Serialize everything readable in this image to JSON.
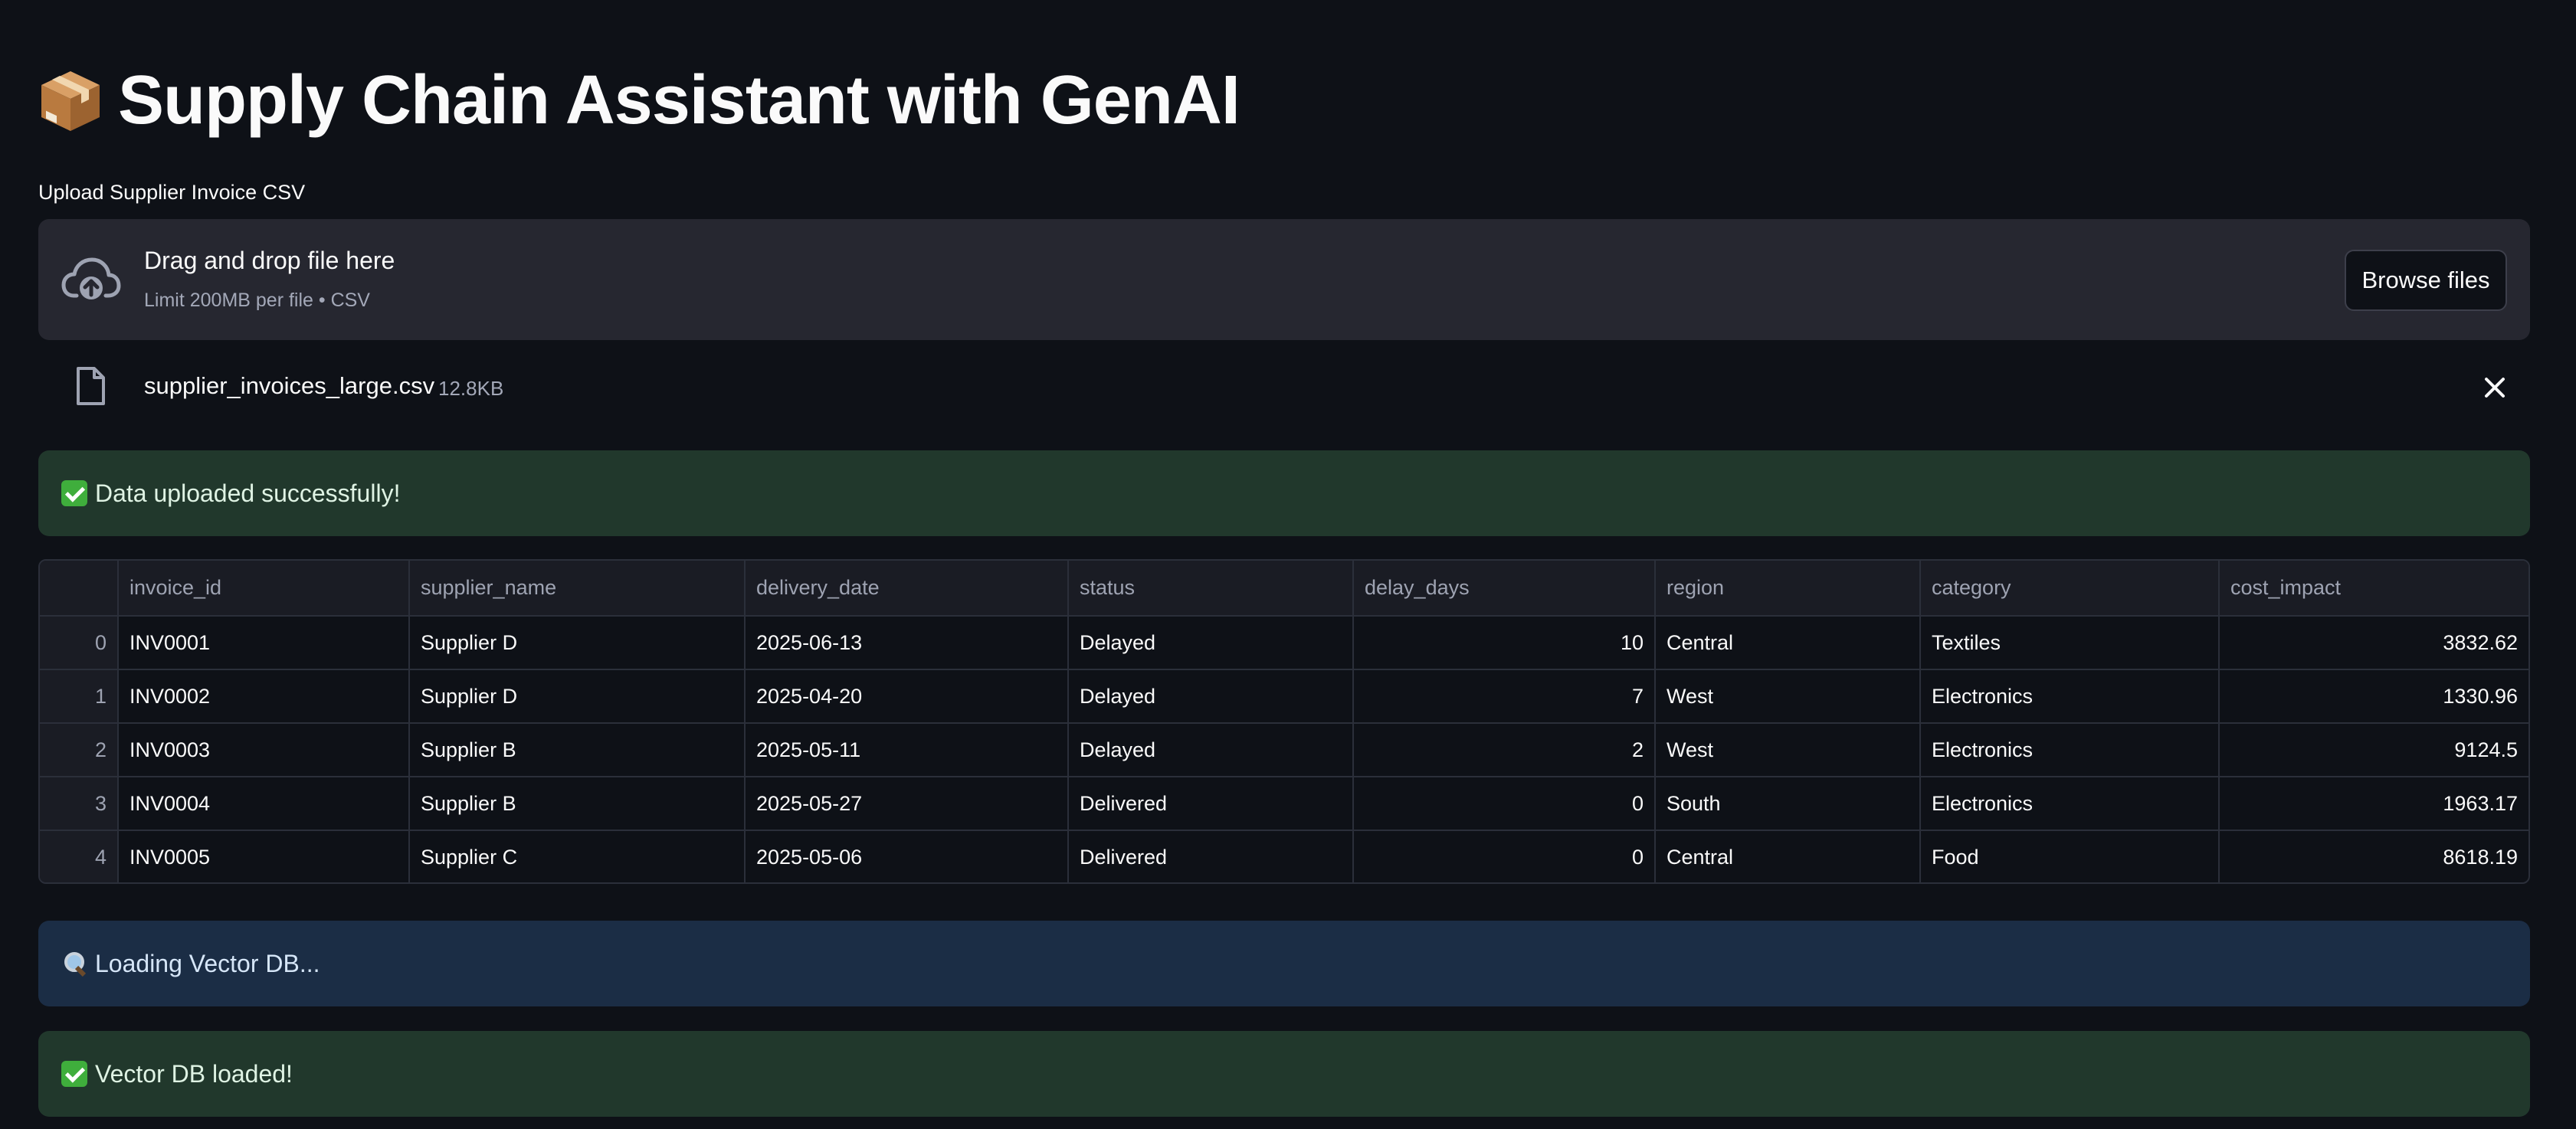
{
  "header": {
    "title": "Supply Chain Assistant with GenAI",
    "title_icon": "package-icon"
  },
  "uploader": {
    "label": "Upload Supplier Invoice CSV",
    "drop_text": "Drag and drop file here",
    "limit_text": "Limit 200MB per file • CSV",
    "browse_label": "Browse files",
    "file_name": "supplier_invoices_large.csv",
    "file_size": "12.8KB"
  },
  "alerts": {
    "upload_success": "Data uploaded successfully!",
    "loading_db": "Loading Vector DB...",
    "db_loaded": "Vector DB loaded!"
  },
  "table": {
    "columns": [
      "",
      "invoice_id",
      "supplier_name",
      "delivery_date",
      "status",
      "delay_days",
      "region",
      "category",
      "cost_impact"
    ],
    "rows": [
      [
        "0",
        "INV0001",
        "Supplier D",
        "2025-06-13",
        "Delayed",
        "10",
        "Central",
        "Textiles",
        "3832.62"
      ],
      [
        "1",
        "INV0002",
        "Supplier D",
        "2025-04-20",
        "Delayed",
        "7",
        "West",
        "Electronics",
        "1330.96"
      ],
      [
        "2",
        "INV0003",
        "Supplier B",
        "2025-05-11",
        "Delayed",
        "2",
        "West",
        "Electronics",
        "9124.5"
      ],
      [
        "3",
        "INV0004",
        "Supplier B",
        "2025-05-27",
        "Delivered",
        "0",
        "South",
        "Electronics",
        "1963.17"
      ],
      [
        "4",
        "INV0005",
        "Supplier C",
        "2025-05-06",
        "Delivered",
        "0",
        "Central",
        "Food",
        "8618.19"
      ]
    ]
  },
  "colors": {
    "background": "#0e1117",
    "dropzone": "#262730",
    "success": "#21382c",
    "info": "#1b2d45"
  }
}
